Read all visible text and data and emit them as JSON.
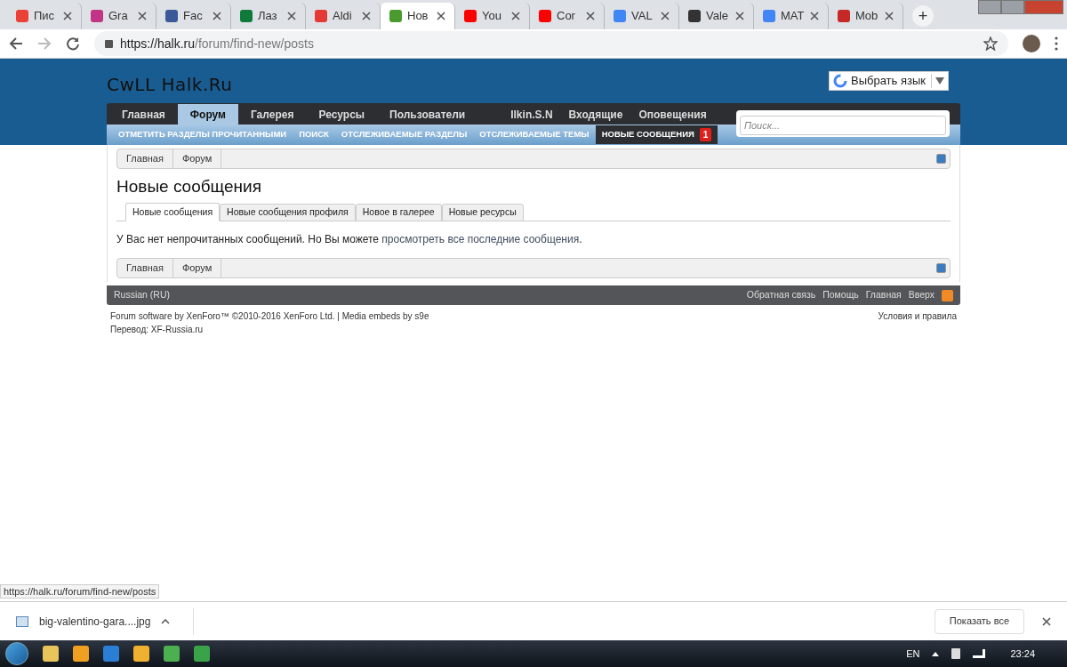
{
  "browser": {
    "tabs": [
      {
        "title": "Пис",
        "color": "#ea4335",
        "selected": false
      },
      {
        "title": "Gra",
        "color": "#c13584",
        "selected": false
      },
      {
        "title": "Fac",
        "color": "#3b5998",
        "selected": false
      },
      {
        "title": "Лаз",
        "color": "#0f7a3a",
        "selected": false
      },
      {
        "title": "Aldi",
        "color": "#e53935",
        "selected": false
      },
      {
        "title": "Нов",
        "color": "#4a9a2e",
        "selected": true
      },
      {
        "title": "You",
        "color": "#ff0000",
        "selected": false
      },
      {
        "title": "Cor",
        "color": "#ff0000",
        "selected": false
      },
      {
        "title": "VAL",
        "color": "#4285f4",
        "selected": false
      },
      {
        "title": "Vale",
        "color": "#333333",
        "selected": false
      },
      {
        "title": "MAT",
        "color": "#4285f4",
        "selected": false
      },
      {
        "title": "Mob",
        "color": "#c62828",
        "selected": false
      }
    ],
    "new_tab": "+",
    "url_host": "https://halk.ru",
    "url_path": "/forum/find-new/posts"
  },
  "site": {
    "logo": "CwLL Halk.Ru",
    "translate": "Выбрать язык",
    "nav": [
      {
        "label": "Главная",
        "selected": false
      },
      {
        "label": "Форум",
        "selected": true
      },
      {
        "label": "Галерея",
        "selected": false
      },
      {
        "label": "Ресурсы",
        "selected": false
      },
      {
        "label": "Пользователи",
        "selected": false
      }
    ],
    "user_nav": [
      "Ilkin.S.N",
      "Входящие",
      "Оповещения"
    ],
    "subnav": [
      {
        "label": "ОТМЕТИТЬ РАЗДЕЛЫ ПРОЧИТАННЫМИ",
        "selected": false
      },
      {
        "label": "ПОИСК",
        "selected": false
      },
      {
        "label": "ОТСЛЕЖИВАЕМЫЕ РАЗДЕЛЫ",
        "selected": false
      },
      {
        "label": "ОТСЛЕЖИВАЕМЫЕ ТЕМЫ",
        "selected": false
      },
      {
        "label": "НОВЫЕ СООБЩЕНИЯ",
        "selected": true,
        "badge": "1"
      }
    ],
    "search": {
      "placeholder": "Поиск..."
    },
    "breadcrumb_top": [
      "Главная",
      "Форум"
    ],
    "title": "Новые сообщения",
    "tabs": [
      {
        "label": "Новые сообщения",
        "selected": true
      },
      {
        "label": "Новые сообщения профиля",
        "selected": false
      },
      {
        "label": "Новое в галерее",
        "selected": false
      },
      {
        "label": "Новые ресурсы",
        "selected": false
      }
    ],
    "message": "У Вас нет непрочитанных сообщений. Но Вы можете ",
    "message_link": "просмотреть все последние сообщения",
    "message_end": ".",
    "breadcrumb_bottom": [
      "Главная",
      "Форум"
    ],
    "footer_language": "Russian (RU)",
    "footer_links": [
      "Обратная связь",
      "Помощь",
      "Главная",
      "Вверх"
    ],
    "copyright": "Forum software by XenForo™ ©2010-2016 XenForo Ltd. | Media embeds by s9e",
    "translation": "Перевод: XF-Russia.ru",
    "terms": "Условия и правила"
  },
  "status_url": "https://halk.ru/forum/find-new/posts",
  "download": {
    "file": "big-valentino-gara....jpg",
    "show_all": "Показать все"
  },
  "taskbar": {
    "lang": "EN",
    "time": "23:24"
  }
}
